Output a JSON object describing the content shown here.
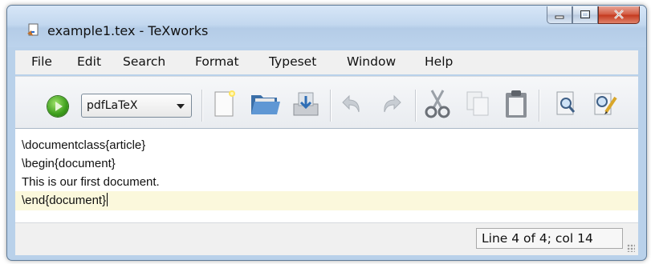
{
  "window": {
    "title": "example1.tex - TeXworks",
    "app_icon": "texworks-document-icon"
  },
  "window_controls": {
    "minimize": "minimize-icon",
    "maximize": "maximize-icon",
    "close": "close-icon"
  },
  "menu": {
    "items": [
      "File",
      "Edit",
      "Search",
      "Format",
      "Typeset",
      "Window",
      "Help"
    ]
  },
  "toolbar": {
    "typeset_engine": "pdfLaTeX",
    "buttons": [
      "new-document",
      "open-folder",
      "save",
      "undo",
      "redo",
      "cut",
      "copy",
      "paste",
      "find",
      "replace"
    ]
  },
  "editor": {
    "lines": [
      "\\documentclass{article}",
      "\\begin{document}",
      "This is our first document.",
      "\\end{document}"
    ],
    "current_line": 4,
    "current_line_color": "#fbf8dc"
  },
  "status": {
    "position": "Line 4 of 4; col 14"
  },
  "colors": {
    "accent": "#b9d1ea",
    "run_button": "#3c9d1c",
    "close_button": "#c3381d"
  }
}
